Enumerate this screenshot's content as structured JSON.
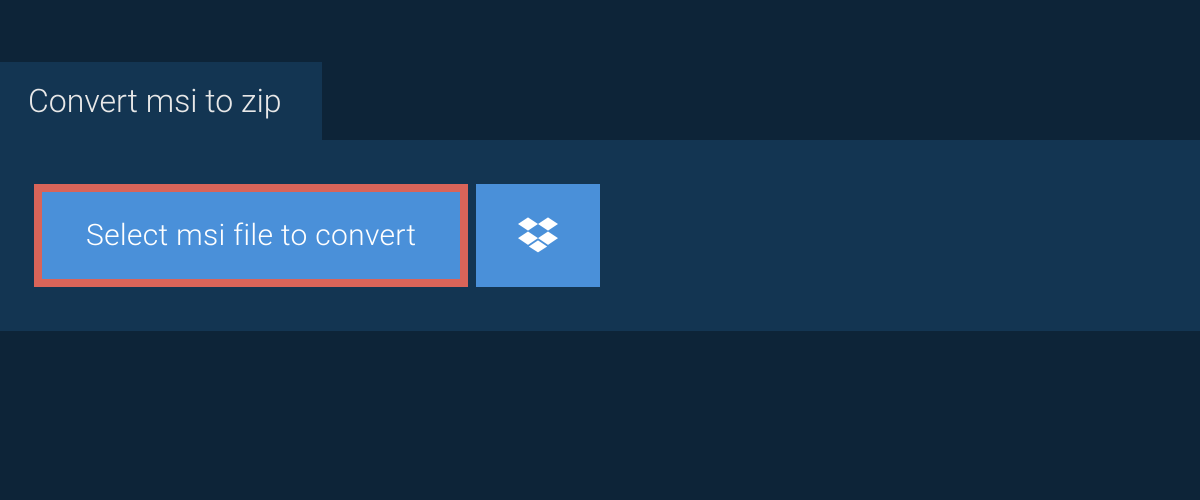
{
  "tab": {
    "label": "Convert msi to zip"
  },
  "actions": {
    "select_file_label": "Select msi file to convert"
  },
  "colors": {
    "background": "#0d2438",
    "panel": "#133552",
    "button": "#4a90d9",
    "highlight_border": "#d96459"
  }
}
